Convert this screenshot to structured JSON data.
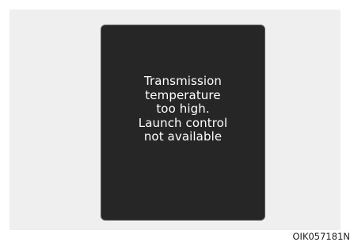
{
  "display": {
    "message_lines": [
      "Transmission",
      "temperature",
      "too high.",
      "Launch control",
      "not available"
    ]
  },
  "figure_code": "OIK057181N"
}
